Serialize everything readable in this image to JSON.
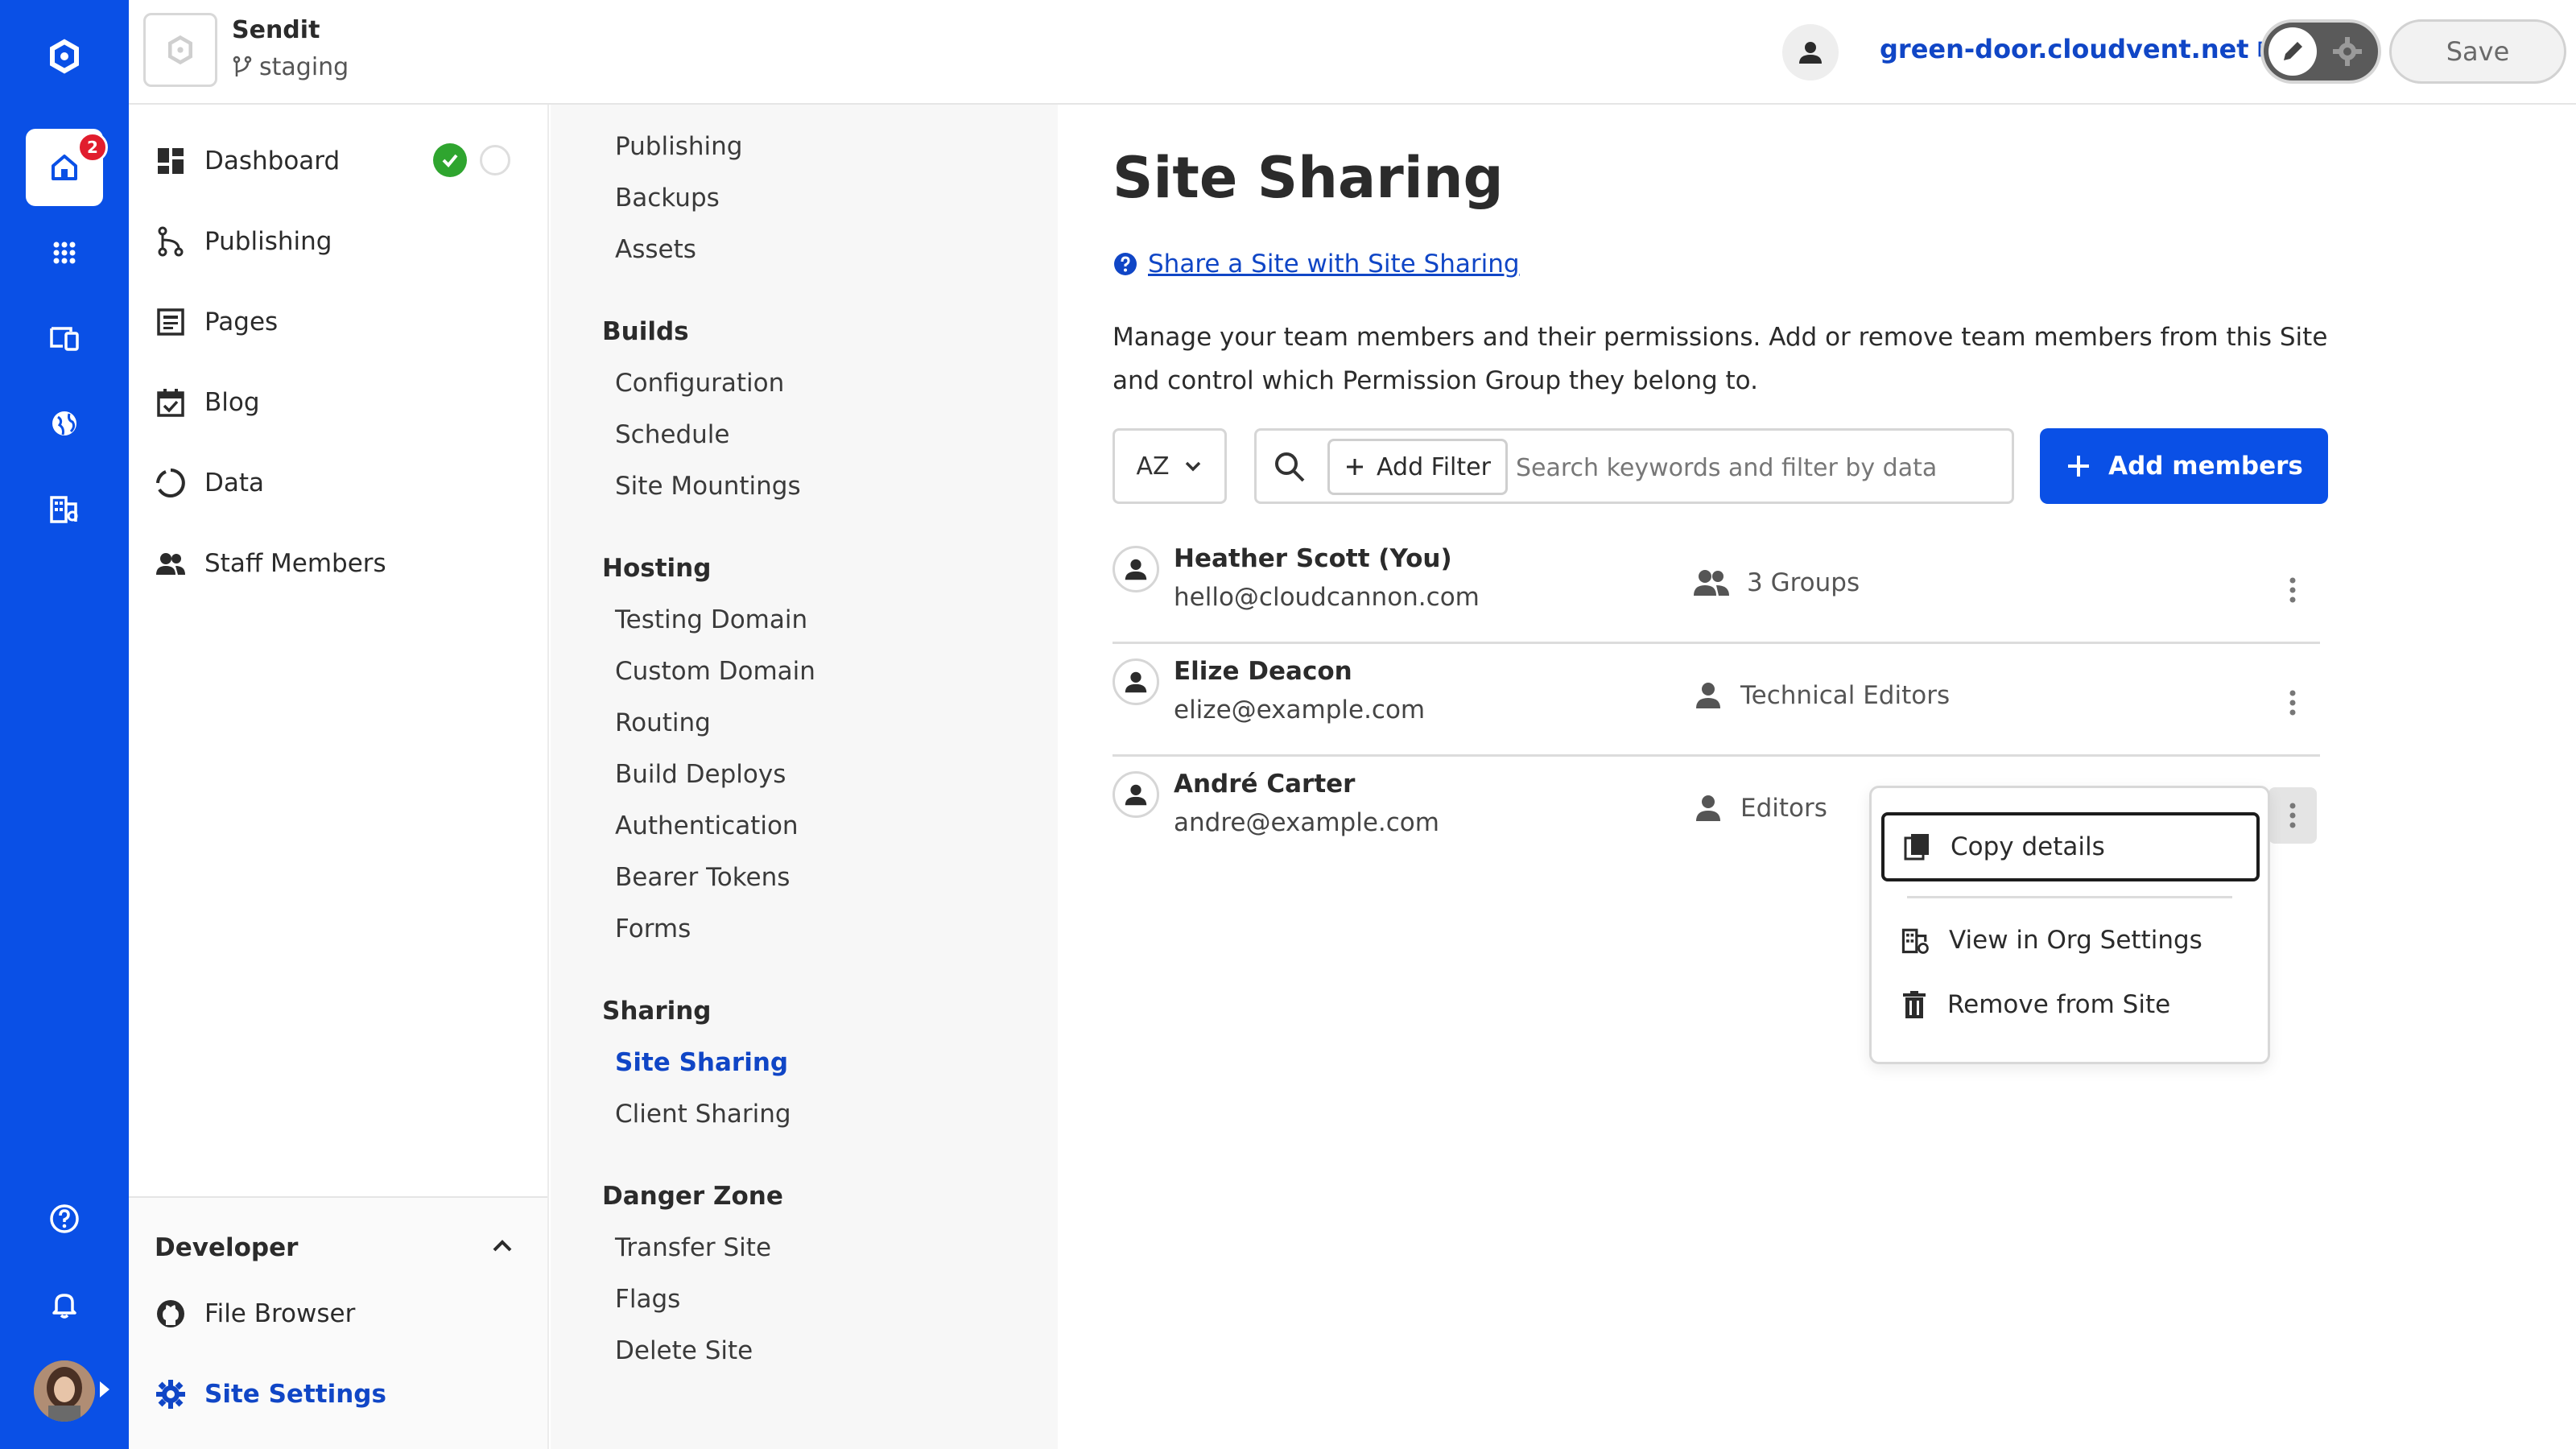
{
  "rail": {
    "notification_count": "2",
    "brand_color": "#0a50e6"
  },
  "topbar": {
    "site_name": "Sendit",
    "branch": "staging",
    "site_url": "green-door.cloudvent.net",
    "save_label": "Save"
  },
  "sitenav": {
    "items": [
      {
        "label": "Dashboard",
        "icon": "dashboard-icon"
      },
      {
        "label": "Publishing",
        "icon": "branch-icon"
      },
      {
        "label": "Pages",
        "icon": "pages-icon"
      },
      {
        "label": "Blog",
        "icon": "calendar-check-icon"
      },
      {
        "label": "Data",
        "icon": "data-icon"
      },
      {
        "label": "Staff Members",
        "icon": "people-icon"
      }
    ],
    "developer": {
      "title": "Developer",
      "items": [
        {
          "label": "File Browser",
          "icon": "github-icon"
        },
        {
          "label": "Site Settings",
          "icon": "gear-icon"
        }
      ]
    }
  },
  "settings": {
    "top_items": [
      "Publishing",
      "Backups",
      "Assets"
    ],
    "sections": [
      {
        "title": "Builds",
        "items": [
          "Configuration",
          "Schedule",
          "Site Mountings"
        ]
      },
      {
        "title": "Hosting",
        "items": [
          "Testing Domain",
          "Custom Domain",
          "Routing",
          "Build Deploys",
          "Authentication",
          "Bearer Tokens",
          "Forms"
        ]
      },
      {
        "title": "Sharing",
        "items": [
          "Site Sharing",
          "Client Sharing"
        ]
      },
      {
        "title": "Danger Zone",
        "items": [
          "Transfer Site",
          "Flags",
          "Delete Site"
        ]
      }
    ]
  },
  "main": {
    "title": "Site Sharing",
    "help_link": "Share a Site with Site Sharing",
    "description": "Manage your team members and their permissions. Add or remove team members from this Site and control which Permission Group they belong to.",
    "sort_label": "AZ",
    "add_filter_label": "Add Filter",
    "search_placeholder": "Search keywords and filter by data",
    "add_members_label": "Add members",
    "members": [
      {
        "name": "Heather Scott (You)",
        "email": "hello@cloudcannon.com",
        "group": "3 Groups",
        "group_icon": "people-icon"
      },
      {
        "name": "Elize Deacon",
        "email": "elize@example.com",
        "group": "Technical Editors",
        "group_icon": "person-icon"
      },
      {
        "name": "André Carter",
        "email": "andre@example.com",
        "group": "Editors",
        "group_icon": "person-icon"
      }
    ]
  },
  "menu": {
    "items": [
      {
        "label": "Copy details",
        "icon": "copy-icon"
      },
      {
        "label": "View in Org Settings",
        "icon": "org-settings-icon"
      },
      {
        "label": "Remove from Site",
        "icon": "trash-icon"
      }
    ]
  }
}
